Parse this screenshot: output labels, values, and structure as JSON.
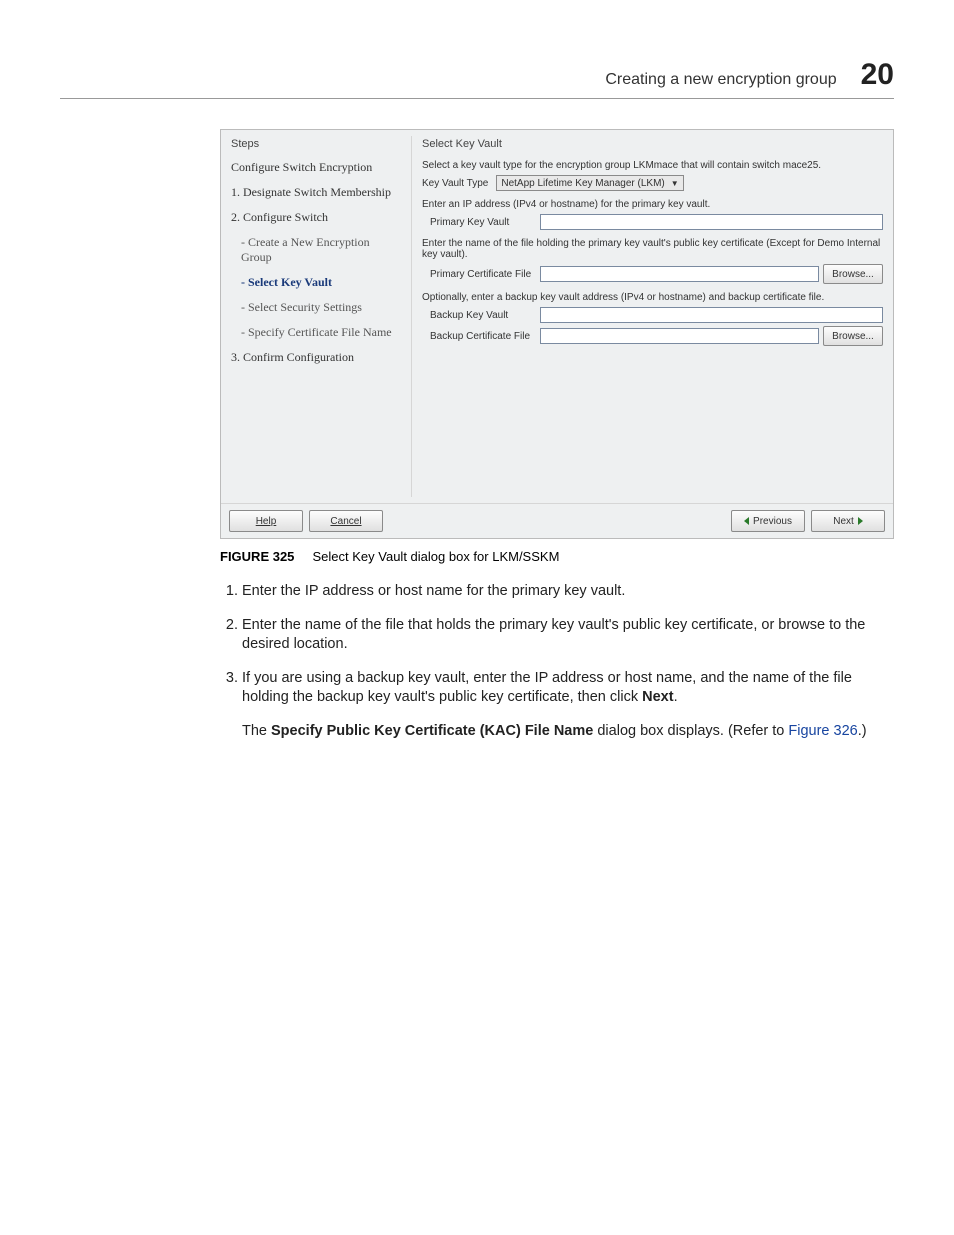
{
  "header": {
    "title": "Creating a new encryption group",
    "chapter_number": "20"
  },
  "dialog": {
    "steps_title": "Steps",
    "content_title": "Select Key Vault",
    "steps_heading": "Configure Switch Encryption",
    "steps": {
      "s1": "1. Designate Switch Membership",
      "s2": "2. Configure Switch",
      "s2a": "- Create a New Encryption Group",
      "s2b": "- Select Key Vault",
      "s2c": "- Select Security Settings",
      "s2d": "- Specify Certificate File Name",
      "s3": "3. Confirm Configuration"
    },
    "instr1": "Select a key vault type for the encryption group LKMmace that will contain switch mace25.",
    "kv_type_label": "Key Vault Type",
    "kv_type_value": "NetApp Lifetime Key Manager (LKM)",
    "instr2": "Enter an IP address (IPv4 or hostname) for the primary key vault.",
    "primary_kv_label": "Primary Key Vault",
    "instr3": "Enter the name of the file holding the primary key vault's public key certificate (Except for Demo Internal key vault).",
    "primary_cert_label": "Primary Certificate File",
    "instr4": "Optionally, enter a backup key vault address (IPv4 or hostname) and backup certificate file.",
    "backup_kv_label": "Backup Key Vault",
    "backup_cert_label": "Backup Certificate File",
    "browse": "Browse...",
    "help": "Help",
    "cancel": "Cancel",
    "previous": "Previous",
    "next": "Next"
  },
  "caption": {
    "label": "FIGURE 325",
    "text": "Select Key Vault dialog box for LKM/SSKM"
  },
  "body": {
    "i1": "Enter the IP address or host name for the primary key vault.",
    "i2": "Enter the name of the file that holds the primary key vault's public key certificate, or browse to the desired location.",
    "i3a": "If you are using a backup key vault, enter the IP address or host name, and the name of the file holding the backup key vault's public key certificate, then click ",
    "i3b": "Next",
    "i3c": ".",
    "r1a": "The ",
    "r1b": "Specify Public Key Certificate (KAC) File Name",
    "r1c": " dialog box displays. (Refer to ",
    "r1d": "Figure 326",
    "r1e": ".)"
  }
}
